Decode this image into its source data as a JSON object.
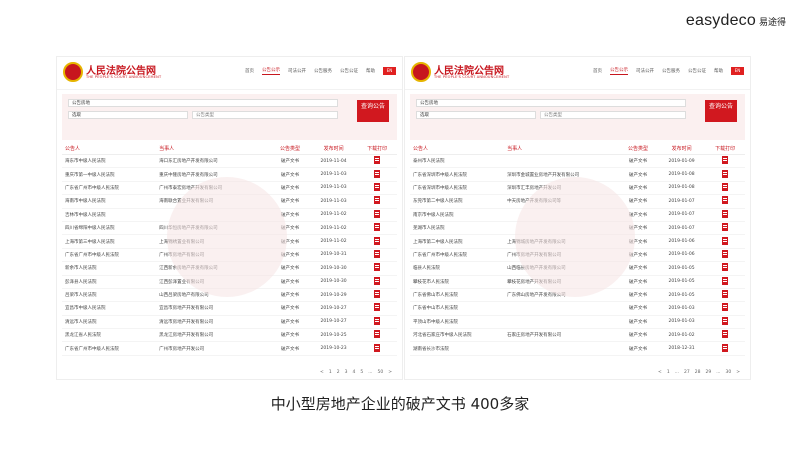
{
  "brand": {
    "logo_text": "easydeco",
    "logo_cn": "易途得"
  },
  "caption": "中小型房地产企业的破产文书 400多家",
  "common": {
    "site_title": "人民法院公告网",
    "site_sub": "THE PEOPLE'S COURT ANNOUNCEMENT",
    "nav": [
      "首页",
      "公告公示",
      "司法公开",
      "公告服务",
      "公告公证",
      "帮助"
    ],
    "flag": "EN",
    "search_value": "公告房地",
    "search_field2": "选取",
    "search_field3": "公告类型",
    "search_button": "查询公告",
    "headers": [
      "公告人",
      "当事人",
      "公告类型",
      "发布时间",
      "下载打印"
    ]
  },
  "panel1": {
    "rows": [
      {
        "court": "海东市中级人民法院",
        "party": "海口东汇房地产开发有限公司",
        "type": "破产文书",
        "date": "2019-11-04"
      },
      {
        "court": "重庆市第一中级人民法院",
        "party": "重庆中隆房地产开发有限公司",
        "type": "破产文书",
        "date": "2019-11-03"
      },
      {
        "court": "广东省广州市中级人民法院",
        "party": "广州市泰宏房地产开发有限公司",
        "type": "破产文书",
        "date": "2019-11-03"
      },
      {
        "court": "海南市中级人民法院",
        "party": "海南联合置业开发有限公司",
        "type": "破产文书",
        "date": "2019-11-03"
      },
      {
        "court": "吉林市中级人民法院",
        "party": "",
        "type": "破产文书",
        "date": "2019-11-02"
      },
      {
        "court": "四川省绵阳中级人民法院",
        "party": "四川华恒房地产开发有限公司",
        "type": "破产文书",
        "date": "2019-11-02"
      },
      {
        "court": "上海市第三中级人民法院",
        "party": "上海锦绣置业有限公司",
        "type": "破产文书",
        "date": "2019-11-02"
      },
      {
        "court": "广东省广州市中级人民法院",
        "party": "广州市房地产有限公司",
        "type": "破产文书",
        "date": "2019-10-31"
      },
      {
        "court": "新余市人民法院",
        "party": "江西新余房地产开发有限公司",
        "type": "破产文书",
        "date": "2019-10-30"
      },
      {
        "court": "彭泽县人民法院",
        "party": "江西彭泽置业有限公司",
        "type": "破产文书",
        "date": "2019-10-30"
      },
      {
        "court": "吕梁市人民法院",
        "party": "山西吕梁房地产有限公司",
        "type": "破产文书",
        "date": "2019-10-29"
      },
      {
        "court": "宜昌市中级人民法院",
        "party": "宜昌市房地产开发有限公司",
        "type": "破产文书",
        "date": "2019-10-27"
      },
      {
        "court": "清远市人民法院",
        "party": "清远市房地产开发有限公司",
        "type": "破产文书",
        "date": "2019-10-27"
      },
      {
        "court": "黑龙江省人民法院",
        "party": "黑龙江房地产开发有限公司",
        "type": "破产文书",
        "date": "2019-10-25"
      },
      {
        "court": "广东省广州市中级人民法院",
        "party": "广州市房地产开发公司",
        "type": "破产文书",
        "date": "2019-10-23"
      }
    ],
    "pager": [
      "<",
      "1",
      "2",
      "3",
      "4",
      "5",
      "...",
      "50",
      ">"
    ]
  },
  "panel2": {
    "rows": [
      {
        "court": "泰州市人民法院",
        "party": "",
        "type": "破产文书",
        "date": "2019-01-09"
      },
      {
        "court": "广东省深圳市中级人民法院",
        "party": "深圳市金城置业房地产开发有限公司",
        "type": "破产文书",
        "date": "2019-01-08"
      },
      {
        "court": "广东省深圳市中级人民法院",
        "party": "深圳市汇丰房地产开发公司",
        "type": "破产文书",
        "date": "2019-01-08"
      },
      {
        "court": "东莞市第二中级人民法院",
        "party": "中天房地产开发有限公司等",
        "type": "破产文书",
        "date": "2019-01-07"
      },
      {
        "court": "南京市中级人民法院",
        "party": "",
        "type": "破产文书",
        "date": "2019-01-07"
      },
      {
        "court": "芜湖市人民法院",
        "party": "",
        "type": "破产文书",
        "date": "2019-01-07"
      },
      {
        "court": "上海市第二中级人民法院",
        "party": "上海锦城房地产开发有限公司",
        "type": "破产文书",
        "date": "2019-01-06"
      },
      {
        "court": "广东省广州市中级人民法院",
        "party": "广州市房地产开发有限公司",
        "type": "破产文书",
        "date": "2019-01-06"
      },
      {
        "court": "临县人民法院",
        "party": "山西临县房地产开发有限公司",
        "type": "破产文书",
        "date": "2019-01-05"
      },
      {
        "court": "攀枝花市人民法院",
        "party": "攀枝花房地产开发有限公司",
        "type": "破产文书",
        "date": "2019-01-05"
      },
      {
        "court": "广东省佛山市人民法院",
        "party": "广东佛山房地产开发有限公司",
        "type": "破产文书",
        "date": "2019-01-05"
      },
      {
        "court": "广东省中山市人民法院",
        "party": "",
        "type": "破产文书",
        "date": "2019-01-03"
      },
      {
        "court": "平顶山市中级人民法院",
        "party": "",
        "type": "破产文书",
        "date": "2019-01-03"
      },
      {
        "court": "河北省石家庄市中级人民法院",
        "party": "石家庄房地产开发有限公司",
        "type": "破产文书",
        "date": "2019-01-02"
      },
      {
        "court": "湖南省长沙市法院",
        "party": "",
        "type": "破产文书",
        "date": "2018-12-31"
      }
    ],
    "pager": [
      "<",
      "1",
      "...",
      "27",
      "28",
      "29",
      "...",
      "30",
      ">"
    ]
  }
}
